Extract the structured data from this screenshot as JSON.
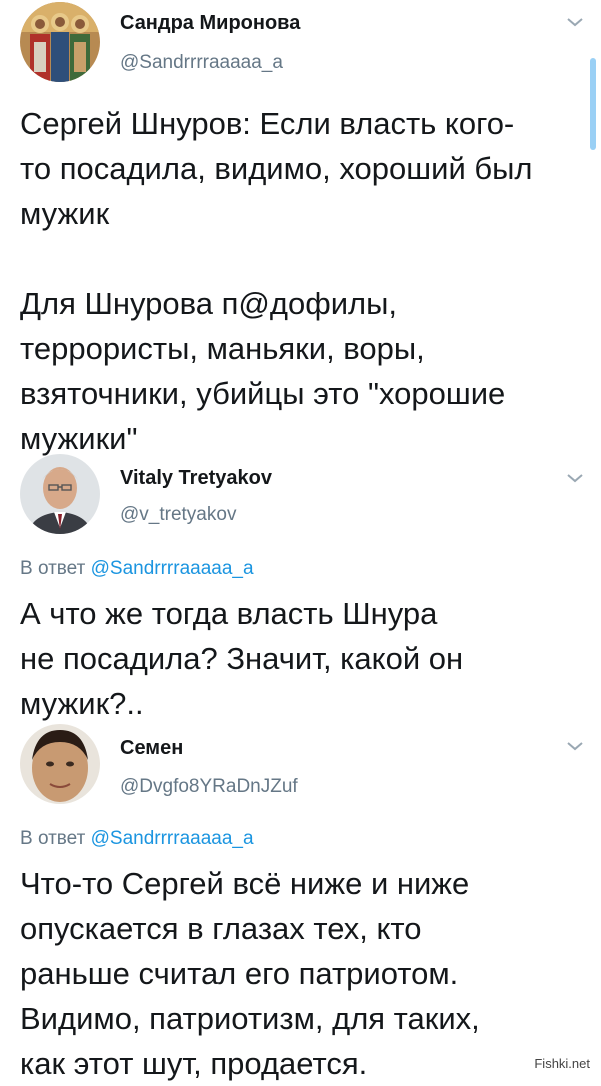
{
  "tweets": [
    {
      "name": "Сандра Миронова",
      "handle": "@Sandrrrraaaaa_a",
      "text": "Сергей Шнуров: Если власть кого-\nто посадила, видимо, хороший был\nмужик\n\nДля Шнурова п@дофилы,\nтеррористы, маньяки, воры,\nвзяточники, убийцы это \"хорошие\nмужики\"",
      "avatar_icon": "icon-painting-avatar"
    },
    {
      "name": "Vitaly Tretyakov",
      "handle": "@v_tretyakov",
      "reply_prefix": "В ответ",
      "reply_to": "@Sandrrrraaaaa_a",
      "text": "А что же тогда власть Шнура\nне посадила? Значит, какой он\nмужик?..",
      "avatar_icon": "man-portrait-avatar"
    },
    {
      "name": "Семен",
      "handle": "@Dvgfo8YRaDnJZuf",
      "reply_prefix": "В ответ",
      "reply_to": "@Sandrrrraaaaa_a",
      "text": "Что-то Сергей всё ниже и ниже\nопускается в глазах тех, кто\nраньше считал его патриотом.\nВидимо, патриотизм, для таких,\nкак этот шут, продается.",
      "avatar_icon": "young-man-avatar"
    }
  ],
  "icons": {
    "chevron": "chevron-down-icon"
  },
  "colors": {
    "text": "#14171a",
    "secondary": "#657786",
    "link": "#1b95e0",
    "scrollbar": "#9ad0f5"
  },
  "watermark": "Fishki.net"
}
